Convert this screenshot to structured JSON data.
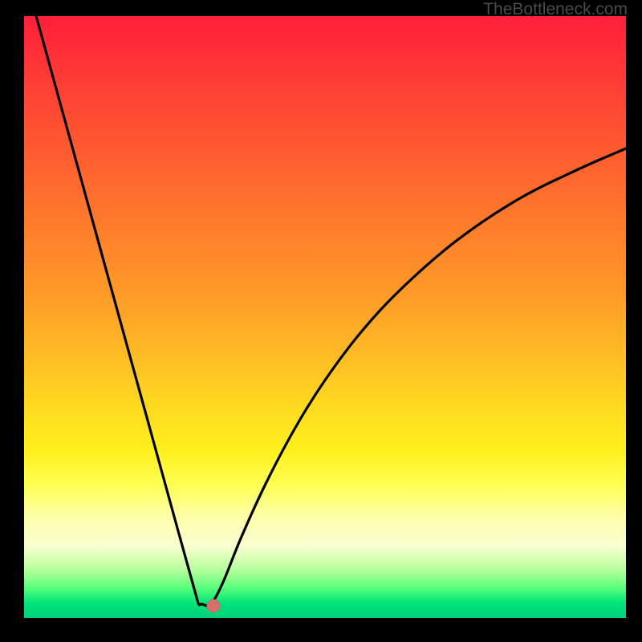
{
  "watermark": "TheBottleneck.com",
  "chart_data": {
    "type": "line",
    "title": "",
    "xlabel": "",
    "ylabel": "",
    "xlim": [
      0,
      100
    ],
    "ylim": [
      0,
      100
    ],
    "grid": false,
    "background_gradient": [
      "#ff1f3a",
      "#ff7a2c",
      "#ffd720",
      "#ffffa8",
      "#00d07a"
    ],
    "series": [
      {
        "name": "bottleneck-curve",
        "color": "#000000",
        "x": [
          2,
          6,
          10,
          14,
          18,
          22,
          25.5,
          27.5,
          28.5,
          29.0,
          29.5,
          31.0,
          33.0,
          36,
          40,
          45,
          50,
          56,
          63,
          72,
          82,
          92,
          100
        ],
        "values": [
          100,
          85.5,
          71,
          56.5,
          42,
          27.5,
          14.8,
          7.6,
          4.0,
          2.3,
          2.3,
          2.3,
          5.8,
          13.2,
          22.0,
          31.5,
          39.5,
          47.5,
          55.0,
          62.8,
          69.5,
          74.5,
          78.0
        ]
      }
    ],
    "annotations": [
      {
        "name": "minimum-marker",
        "x": 31.5,
        "y": 2.0,
        "color": "#d4716b"
      }
    ]
  }
}
